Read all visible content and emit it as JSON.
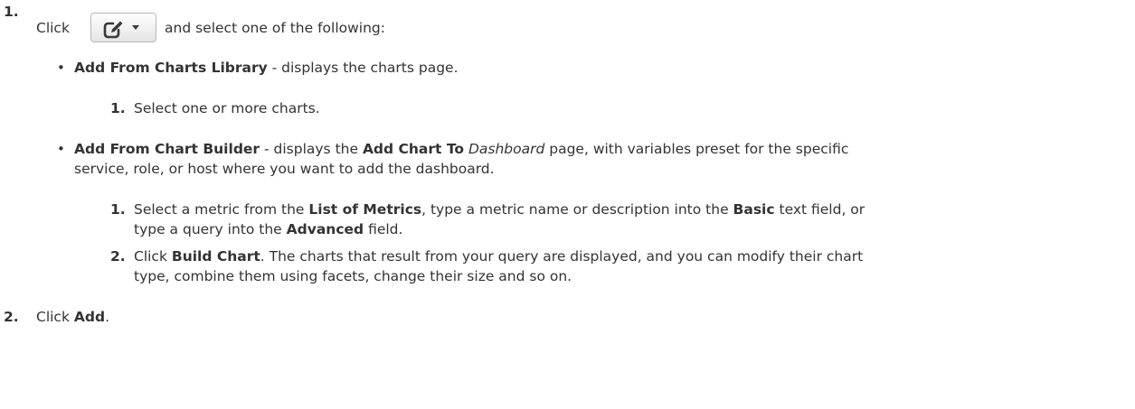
{
  "step1": {
    "number": "1.",
    "click": "Click",
    "after_button": "and select one of the following:",
    "button_icon": "edit-dropdown-icon",
    "options": [
      {
        "title": "Add From Charts Library",
        "text": " - displays the charts page.",
        "substeps": [
          {
            "number": "1.",
            "text": "Select one or more charts."
          }
        ]
      },
      {
        "title": "Add From Chart Builder",
        "text_a": " - displays the ",
        "bold_a": "Add Chart To",
        "italic_a": "Dashboard",
        "text_b": " page, with variables preset for the specific",
        "line2": "service, role, or host where you want to add the dashboard.",
        "substeps": [
          {
            "number": "1.",
            "a": "Select a metric from the ",
            "b": "List of Metrics",
            "c": ", type a metric name or description into the ",
            "d": "Basic",
            "e": " text field, or",
            "f": "type a query into the ",
            "g": "Advanced",
            "h": " field."
          },
          {
            "number": "2.",
            "a": "Click ",
            "b": "Build Chart",
            "c": ". The charts that result from your query are displayed, and you can modify their chart",
            "line2": "type, combine them using facets, change their size and so on."
          }
        ]
      }
    ]
  },
  "step2": {
    "number": "2.",
    "a": "Click ",
    "b": "Add",
    "c": "."
  }
}
